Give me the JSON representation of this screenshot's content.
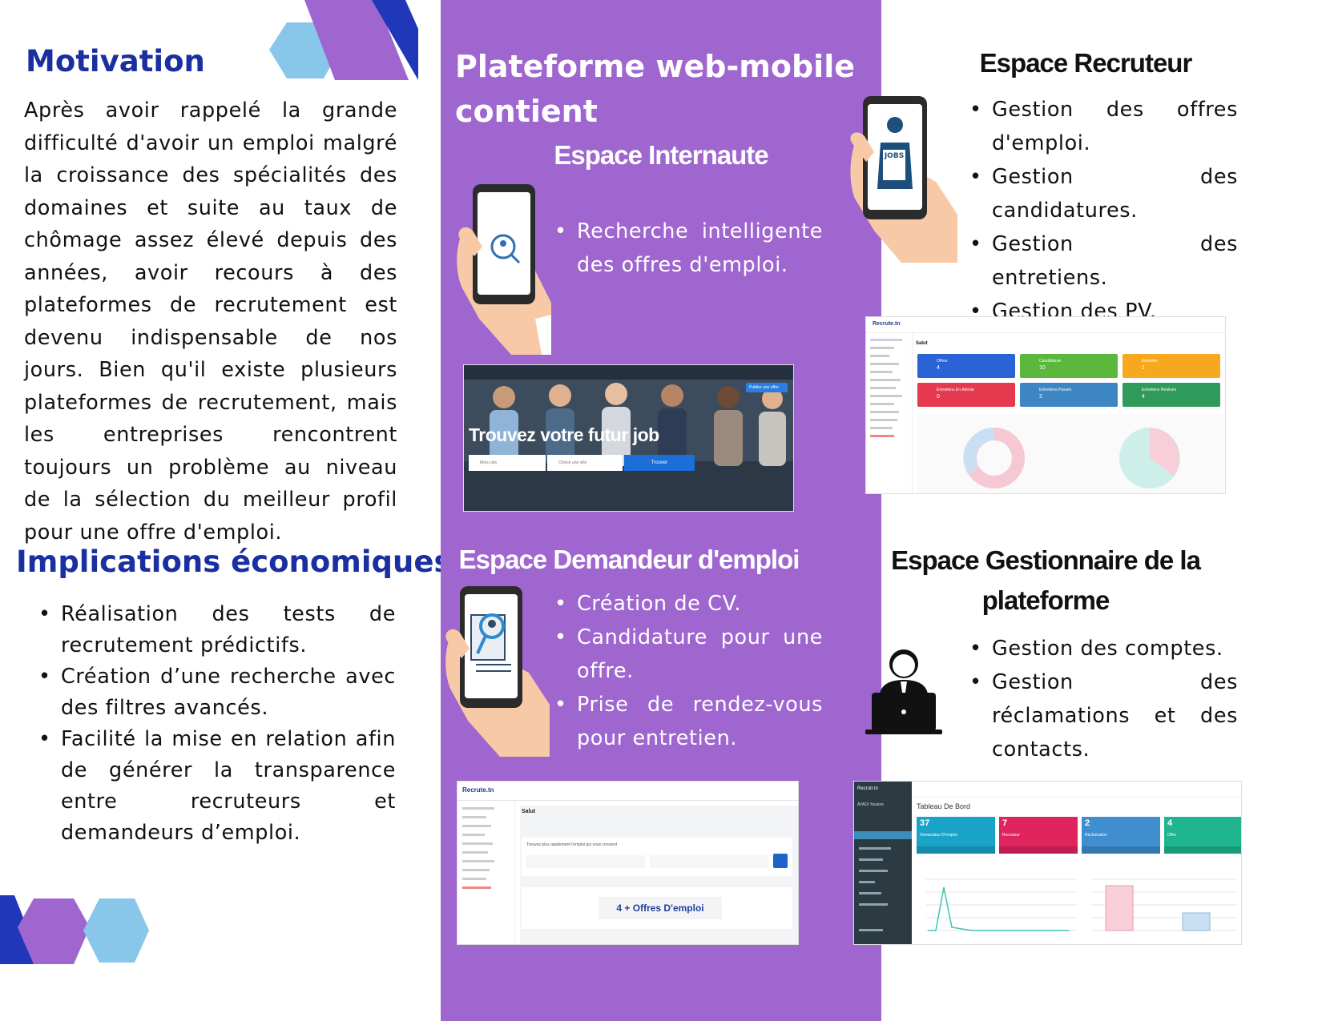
{
  "left": {
    "motivation_title": "Motivation",
    "motivation_text": "Après avoir rappelé la grande difficulté d'avoir un emploi malgré la croissance des spécialités des domaines et suite au taux de chômage assez élevé depuis des années, avoir recours à des plateformes de recrutement est devenu indispensable de nos jours. Bien qu'il existe plusieurs plateformes de recrutement, mais les entreprises rencontrent toujours un problème au niveau de la sélection du meilleur profil pour une offre d'emploi.",
    "implications_title": "Implications économiques",
    "implications": [
      "Réalisation des tests de recrutement prédictifs.",
      "Création d’une recherche avec des filtres avancés.",
      "Facilité la mise en relation afin de générer la transparence entre recruteurs et demandeurs d’emploi."
    ]
  },
  "middle": {
    "title_line1": "Plateforme web-mobile",
    "title_line2": "contient",
    "internaute_title": "Espace Internaute",
    "internaute_items": [
      "Recherche intelligente des offres d'emploi."
    ],
    "hero_text": "Trouvez votre futur job",
    "hero_publish": "Publier une offre",
    "hero_search_btn": "Trouver",
    "hero_field1": "Mots clés",
    "hero_field2": "Choisir une ville",
    "demandeur_title": "Espace Demandeur d'emploi",
    "demandeur_items": [
      "Création de CV.",
      "Candidature pour une offre.",
      "Prise de rendez-vous pour entretien."
    ],
    "shot_brand": "Recrute.tn",
    "shot_salut": "Salut",
    "shot_search_label": "Trouvez plus rapidement l'emploi qui vous convient",
    "shot_offers": "4 + Offres D'emploi"
  },
  "right": {
    "recruteur_title": "Espace Recruteur",
    "recruteur_items": [
      "Gestion des offres d'emploi.",
      "Gestion des candidatures.",
      "Gestion des entretiens.",
      "Gestion des PV."
    ],
    "jobs_sign": "JOBS",
    "gestionnaire_title_line1": "Espace Gestionnaire de la",
    "gestionnaire_title_line2": "plateforme",
    "gestionnaire_items": [
      "Gestion des comptes.",
      "Gestion des réclamations et des contacts."
    ],
    "dash_title": "Tableau De Bord",
    "dash_brand": "Recrutr.tn",
    "dash_user": "AYADI Yassine",
    "dash_cards": [
      {
        "value": "37",
        "label": "Demandeur D'emploi",
        "color": "#1aa3c8"
      },
      {
        "value": "7",
        "label": "Recruteur",
        "color": "#e0245e"
      },
      {
        "value": "2",
        "label": "Réclamation",
        "color": "#3e8ed0"
      },
      {
        "value": "4",
        "label": "Offre",
        "color": "#1fb58f"
      }
    ],
    "recruteur_cards": [
      {
        "label": "Offres",
        "value": "4",
        "color": "#2a63d6"
      },
      {
        "label": "Candidature",
        "value": "10",
        "color": "#5cb83c"
      },
      {
        "label": "Entretien",
        "value": "1",
        "color": "#f7a81e"
      },
      {
        "label": "Entretiens En Attente",
        "value": "0",
        "color": "#e53950"
      },
      {
        "label": "Entretiens Passés",
        "value": "2",
        "color": "#3c86c4"
      },
      {
        "label": "Entretiens Réalisés",
        "value": "4",
        "color": "#2f9a5a"
      }
    ]
  }
}
